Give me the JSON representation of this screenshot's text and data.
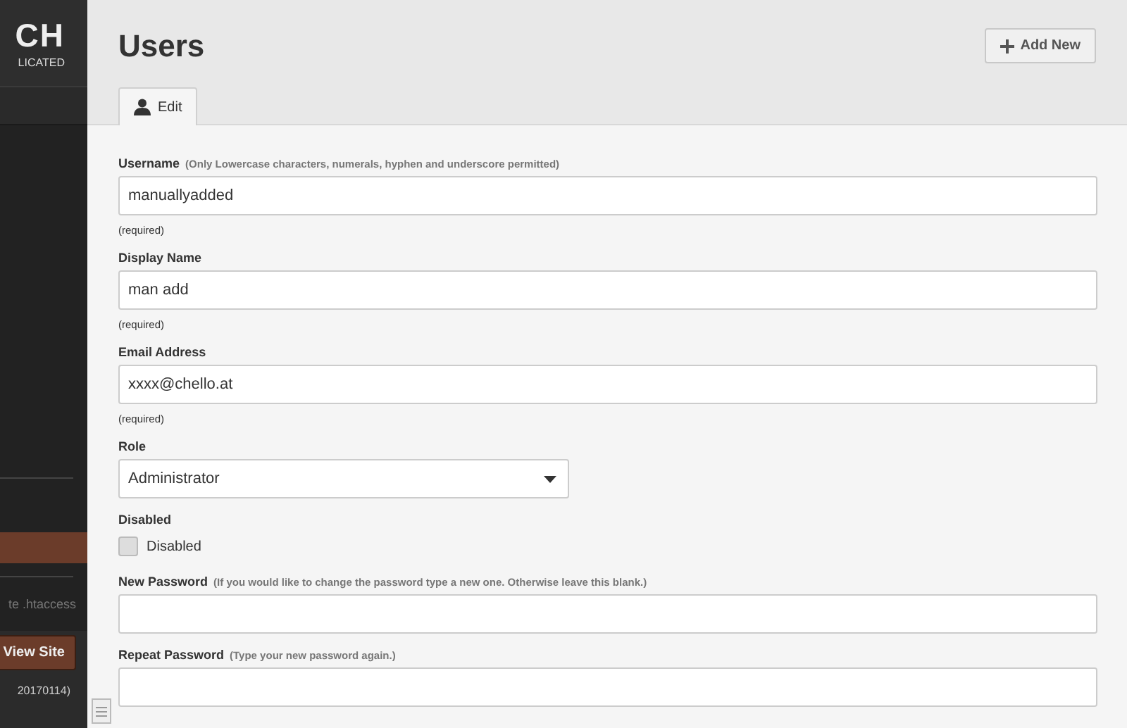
{
  "sidebar": {
    "logo_text": "CH",
    "logo_subtext": "LICATED",
    "active_item": {
      "selected": true
    },
    "link_text": "te .htaccess",
    "view_site_button": "View Site",
    "version": "20170114)"
  },
  "page": {
    "title": "Users",
    "add_button": "Add New"
  },
  "tabs": [
    {
      "label": "Edit",
      "selected": true
    }
  ],
  "fields": [
    {
      "kind": "text",
      "label": "Username",
      "hint": "(Only Lowercase characters, numerals, hyphen and underscore permitted)",
      "value": "manuallyadded",
      "note": "(required)"
    },
    {
      "kind": "text",
      "label": "Display Name",
      "value": "man add",
      "note": "(required)"
    },
    {
      "kind": "text",
      "label": "Email Address",
      "value": "xxxx@chello.at",
      "note": "(required)"
    },
    {
      "kind": "select",
      "label": "Role",
      "value": "Administrator"
    },
    {
      "kind": "checkbox",
      "label": "Disabled",
      "option": "Disabled",
      "checked": false
    },
    {
      "kind": "password",
      "label": "New Password",
      "hint": "(If you would like to change the password type a new one. Otherwise leave this blank.)"
    },
    {
      "kind": "password",
      "label": "Repeat Password",
      "hint": "(Type your new password again.)"
    }
  ]
}
